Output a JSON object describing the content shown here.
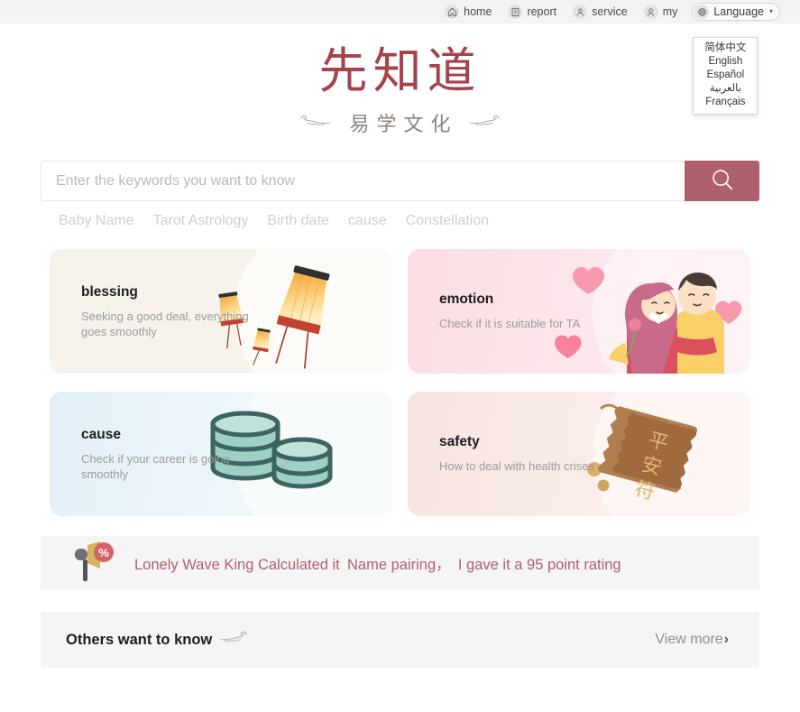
{
  "topnav": {
    "items": [
      {
        "label": "home",
        "icon": "home-icon"
      },
      {
        "label": "report",
        "icon": "report-icon"
      },
      {
        "label": "service",
        "icon": "service-icon"
      },
      {
        "label": "my",
        "icon": "user-icon"
      }
    ],
    "language": {
      "label": "Language",
      "icon": "globe-icon",
      "caret": "▾",
      "options": [
        "简体中文",
        "English",
        "Español",
        "بالعربية",
        "Français"
      ]
    }
  },
  "logo": {
    "main": "先知道",
    "sub": "易学文化",
    "color": "#a6424a"
  },
  "search": {
    "placeholder": "Enter the keywords you want to know",
    "value": "",
    "button_icon": "search-icon",
    "button_color": "#b0606a"
  },
  "hot_tags": [
    "Baby Name",
    "Tarot Astrology",
    "Birth date",
    "cause",
    "Constellation"
  ],
  "cards": [
    {
      "title": "blessing",
      "desc": "Seeking a good deal, everything goes smoothly",
      "art": "sky-lantern-illustration",
      "bg": "#f7f3ec"
    },
    {
      "title": "emotion",
      "desc": "Check if it is suitable for TA",
      "art": "couple-hugging-illustration",
      "bg": "#fbdde3"
    },
    {
      "title": "cause",
      "desc": "Check if your career is going smoothly",
      "art": "coin-stack-illustration",
      "bg": "#e3f0f8"
    },
    {
      "title": "safety",
      "desc": "How to deal with health crises",
      "art": "peace-amulet-illustration",
      "bg": "#f7e3e0"
    }
  ],
  "announcement": {
    "icon": "megaphone-percent-icon",
    "text": "Lonely Wave King Calculated it Name pairing， I gave it a 95 point rating",
    "color": "#b0606a"
  },
  "others": {
    "title": "Others want to know",
    "ornament": "cloud-ornament-icon",
    "view_more": "View more",
    "view_more_arrow": "›"
  }
}
